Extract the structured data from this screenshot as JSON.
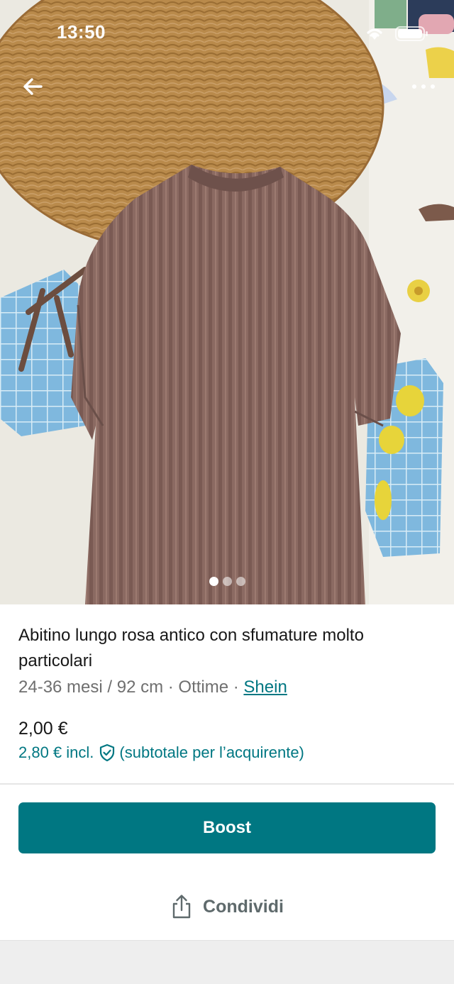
{
  "status_bar": {
    "time": "13:50",
    "icons": [
      "wifi-icon",
      "battery-icon"
    ]
  },
  "photo": {
    "description_icon": "product-photo",
    "pager": {
      "count": 3,
      "active_index": 0
    }
  },
  "item": {
    "title": "Abitino lungo rosa antico con sfumature molto particolari",
    "size_condition": "24-36 mesi / 92 cm · Ottime · ",
    "brand": "Shein",
    "price": "2,00 €",
    "price_incl": "2,80 € incl.",
    "price_incl_note": "(subtotale per l’acquirente)"
  },
  "actions": {
    "boost_label": "Boost",
    "share_label": "Condividi"
  },
  "colors": {
    "accent": "#007782",
    "text": "#171717",
    "muted": "#6f6f6f"
  }
}
